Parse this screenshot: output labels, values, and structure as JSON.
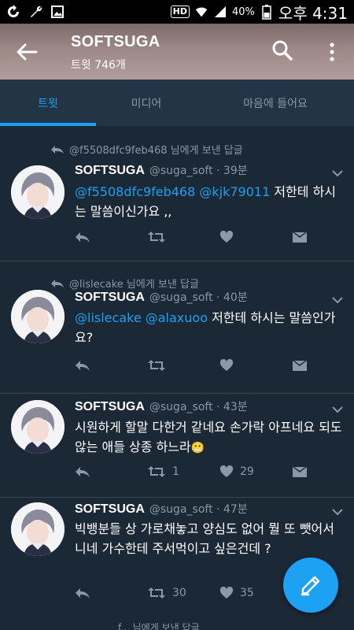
{
  "status_bar": {
    "hd": "HD",
    "battery": "40%",
    "clock": "오후 4:31"
  },
  "header": {
    "title": "SOFTSUGA",
    "subtitle": "트윗 746개"
  },
  "tabs": [
    {
      "label": "트윗",
      "active": true
    },
    {
      "label": "미디어",
      "active": false
    },
    {
      "label": "마음에 들어요",
      "active": false
    }
  ],
  "tweets": [
    {
      "reply_context": "@f5508dfc9feb468 님에게 보낸 답글",
      "name": "SOFTSUGA",
      "handle": "@suga_soft · 39분",
      "mentions": "@f5508dfc9feb468 @kjk79011",
      "text_after": " 저한테 하시는 말씀이신가요 ,,",
      "retweets": "",
      "likes": ""
    },
    {
      "reply_context": "@lislecake 님에게 보낸 답글",
      "name": "SOFTSUGA",
      "handle": "@suga_soft · 40분",
      "mentions": "@lislecake @alaxuoo",
      "text_after": " 저한테 하시는 말씀인가요?",
      "retweets": "",
      "likes": ""
    },
    {
      "reply_context": "",
      "name": "SOFTSUGA",
      "handle": "@suga_soft · 43분",
      "mentions": "",
      "text_after": "시원하게 할말 다한거 같네요 손가락 아프네요 되도 않는 애들 상종 하느라",
      "emoji": "😬",
      "retweets": "1",
      "likes": "29"
    },
    {
      "reply_context": "",
      "name": "SOFTSUGA",
      "handle": "@suga_soft · 47분",
      "mentions": "",
      "text_after": "빅뱅분들 상 가로채놓고 양심도 없어 뭘 또 뺏어서 니네 가수한테 주서먹이고 싶은건데 ?",
      "retweets": "30",
      "likes": "35"
    }
  ],
  "bottom_peek": "f... 님에게 보낸 답글",
  "colors": {
    "background": "#1b2836",
    "accent": "#1da1f2",
    "muted": "#8b98a5"
  },
  "icons": [
    "back-arrow-icon",
    "search-icon",
    "more-vert-icon",
    "reply-icon",
    "retweet-icon",
    "heart-icon",
    "dm-icon",
    "caret-down-icon",
    "compose-icon"
  ]
}
